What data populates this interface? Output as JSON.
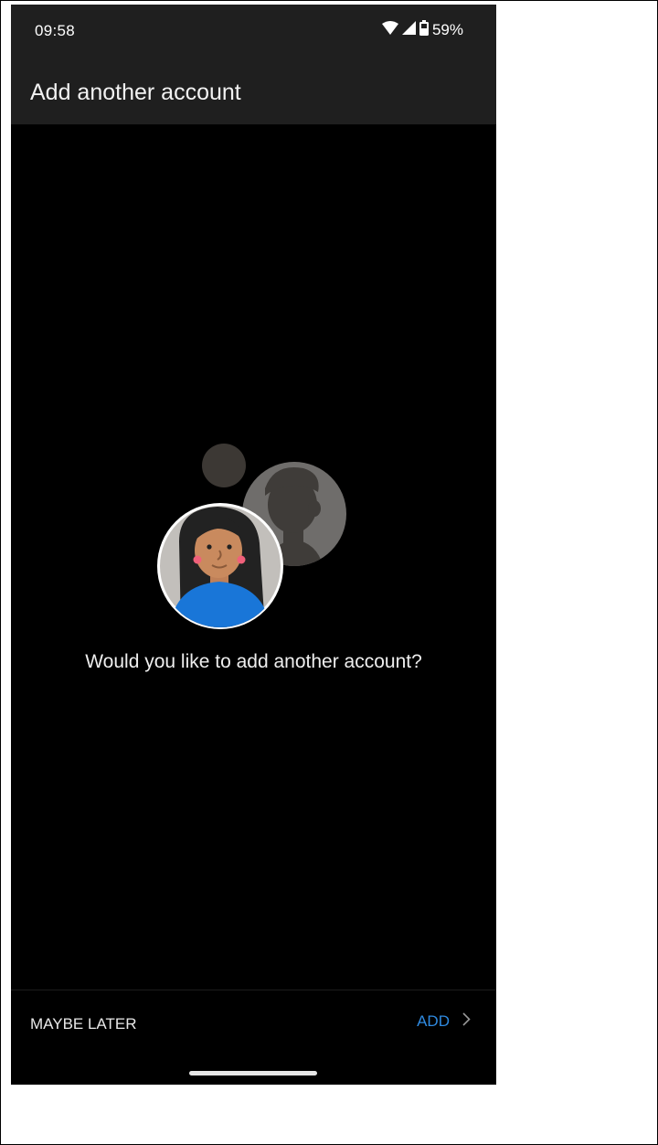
{
  "status_bar": {
    "time": "09:58",
    "battery": "59%",
    "icons": [
      "wifi-icon",
      "cell-signal-icon",
      "battery-icon"
    ]
  },
  "app_bar": {
    "title": "Add another account"
  },
  "content": {
    "illustration": "two-accounts-illustration",
    "question": "Would you like to add another account?"
  },
  "footer": {
    "maybe_later": "MAYBE LATER",
    "add": "ADD",
    "add_icon": "chevron-right-icon"
  },
  "colors": {
    "accent": "#2f8ae0",
    "background": "#000000",
    "bar": "#1f1f1f"
  }
}
